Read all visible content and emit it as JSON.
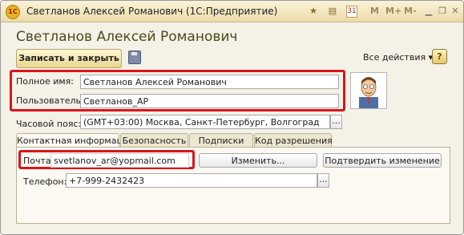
{
  "window": {
    "title": "Светланов Алексей Романович  (1С:Предприятие)",
    "toolbar_icons": [
      "star-icon",
      "notes-icon",
      "calendar-icon"
    ],
    "toolbar_labels": [
      "M",
      "M+",
      "M-"
    ],
    "controls": [
      "minimize-icon",
      "restore-icon",
      "close-icon"
    ]
  },
  "header": {
    "title": "Светланов Алексей Романович"
  },
  "toolbar": {
    "save_close_label": "Записать и закрыть",
    "all_actions_label": "Все действия ▾",
    "help_label": "?"
  },
  "form": {
    "full_name_label": "Полное имя:",
    "full_name_value": "Светланов Алексей Романович",
    "user_label": "Пользователь:",
    "user_value": "Светланов_АР",
    "timezone_label": "Часовой пояс:",
    "timezone_value": "(GMT+03:00) Москва, Санкт-Петербург, Волгоград",
    "select_label": "..."
  },
  "tabs": [
    {
      "label": "Контактная информация",
      "active": true
    },
    {
      "label": "Безопасность",
      "active": false
    },
    {
      "label": "Подписки",
      "active": false
    },
    {
      "label": "Код разрешения",
      "active": false
    }
  ],
  "contact": {
    "email_label": "Почта:",
    "email_value": "svetlanov_ar@yopmail.com",
    "change_button": "Изменить...",
    "confirm_button": "Подтвердить изменение",
    "phone_label": "Телефон:",
    "phone_value": "+7-999-2432423"
  },
  "colors": {
    "highlight": "#d9151d",
    "title_bar": "#f4e8c2",
    "header_text": "#4a4a1e"
  }
}
